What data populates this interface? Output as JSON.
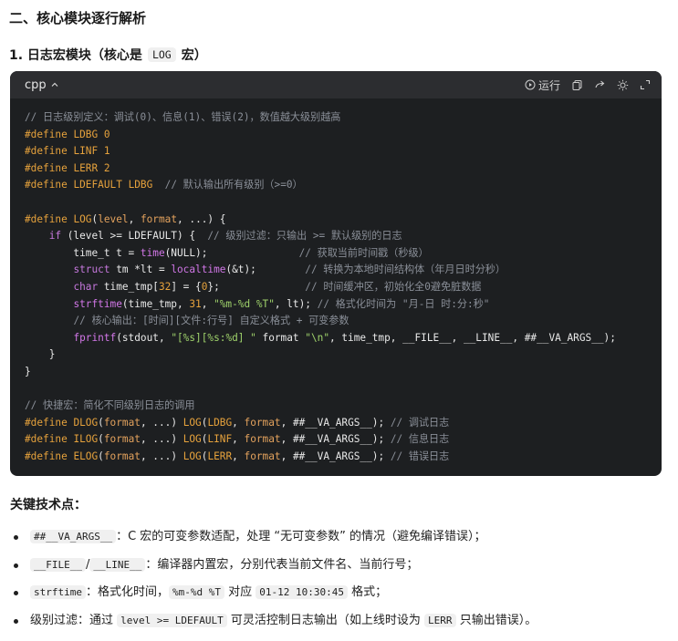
{
  "heading": "二、核心模块逐行解析",
  "subheading": {
    "prefix": "1. 日志宏模块（核心是",
    "code": "LOG",
    "suffix": "宏）"
  },
  "code_block": {
    "language": "cpp",
    "run_label": "运行",
    "lines": [
      "// 日志级别定义：调试(0)、信息(1)、错误(2)，数值越大级别越高",
      "#define LDBG 0",
      "#define LINF 1",
      "#define LERR 2",
      "#define LDEFAULT LDBG  // 默认输出所有级别（>=0）",
      "",
      "#define LOG(level, format, ...) {",
      "    if (level >= LDEFAULT) {  // 级别过滤：只输出 >= 默认级别的日志",
      "        time_t t = time(NULL);               // 获取当前时间戳（秒级）",
      "        struct tm *lt = localtime(&t);        // 转换为本地时间结构体（年月日时分秒）",
      "        char time_tmp[32] = {0};              // 时间缓冲区，初始化全0避免脏数据",
      "        strftime(time_tmp, 31, \"%m-%d %T\", lt); // 格式化时间为 \"月-日 时:分:秒\"",
      "        // 核心输出：[时间][文件:行号] 自定义格式 + 可变参数",
      "        fprintf(stdout, \"[%s][%s:%d] \" format \"\\n\", time_tmp, __FILE__, __LINE__, ##__VA_ARGS__);",
      "    }",
      "}",
      "",
      "// 快捷宏：简化不同级别日志的调用",
      "#define DLOG(format, ...) LOG(LDBG, format, ##__VA_ARGS__); // 调试日志",
      "#define ILOG(format, ...) LOG(LINF, format, ##__VA_ARGS__); // 信息日志",
      "#define ELOG(format, ...) LOG(LERR, format, ##__VA_ARGS__); // 错误日志"
    ]
  },
  "key_points_title": "关键技术点：",
  "key_points": [
    {
      "code1": "##__VA_ARGS__",
      "text1": "：C 宏的可变参数适配，处理 “无可变参数” 的情况（避免编译错误）；"
    },
    {
      "code1": "__FILE__",
      "sep": "/",
      "code2": "__LINE__",
      "text1": "：编译器内置宏，分别代表当前文件名、当前行号；"
    },
    {
      "code1": "strftime",
      "text1": "：格式化时间，",
      "code2": "%m-%d %T",
      "text2": "对应",
      "code3": "01-12 10:30:45",
      "text3": "格式；"
    },
    {
      "prefix": "级别过滤：通过",
      "code1": "level >= LDEFAULT",
      "text1": "可灵活控制日志输出（如上线时设为",
      "code2": "LERR",
      "text2": "只输出错误）。"
    }
  ]
}
